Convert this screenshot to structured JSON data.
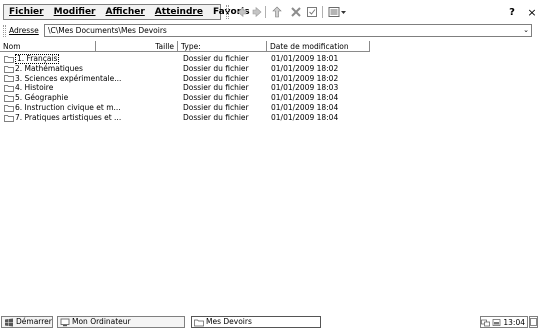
{
  "menubar": {
    "items": [
      "Fichier",
      "Modifier",
      "Afficher",
      "Atteindre",
      "Favoris"
    ],
    "toolbar_icons": [
      "back-icon",
      "forward-icon",
      "up-folder-icon",
      "delete-icon",
      "properties-icon",
      "views-icon"
    ],
    "help_label": "?",
    "close_label": "×"
  },
  "address": {
    "label": "Adresse",
    "value": "\\C\\Mes Documents\\Mes Devoirs"
  },
  "columns": {
    "name": "Nom",
    "size": "Taille",
    "type": "Type:",
    "date": "Date de modification"
  },
  "files": [
    {
      "name": "1. Français",
      "type": "Dossier du fichier",
      "date": "01/01/2009 18:01"
    },
    {
      "name": "2. Mathématiques",
      "type": "Dossier du fichier",
      "date": "01/01/2009 18:02"
    },
    {
      "name": "3. Sciences expérimentale...",
      "type": "Dossier du fichier",
      "date": "01/01/2009 18:02"
    },
    {
      "name": "4. Histoire",
      "type": "Dossier du fichier",
      "date": "01/01/2009 18:03"
    },
    {
      "name": "5. Géographie",
      "type": "Dossier du fichier",
      "date": "01/01/2009 18:04"
    },
    {
      "name": "6. Instruction civique et m...",
      "type": "Dossier du fichier",
      "date": "01/01/2009 18:04"
    },
    {
      "name": "7. Pratiques artistiques et ...",
      "type": "Dossier du fichier",
      "date": "01/01/2009 18:04"
    }
  ],
  "taskbar": {
    "start": "Démarrer",
    "tasks": [
      "Mon Ordinateur",
      "Mes Devoirs"
    ],
    "time": "13:04"
  }
}
